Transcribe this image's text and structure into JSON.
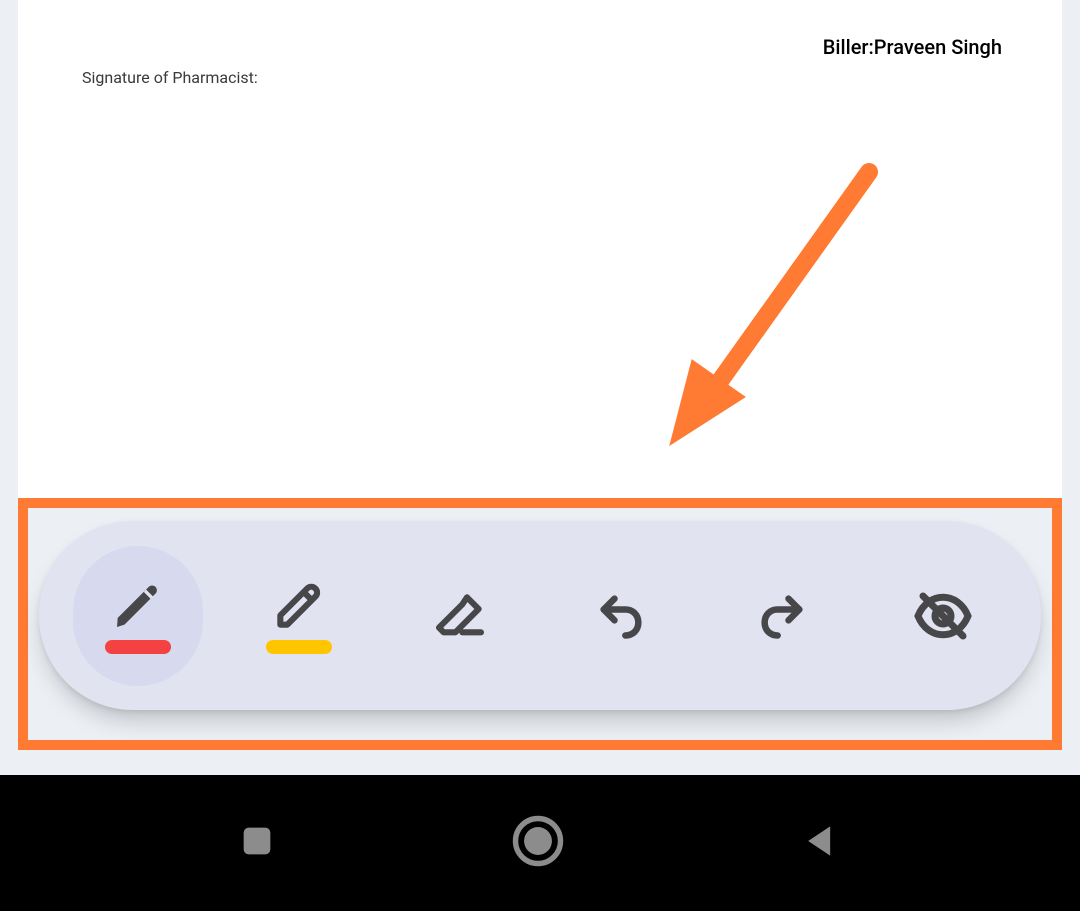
{
  "document": {
    "biller_label": "Biller:",
    "biller_name": "Praveen Singh",
    "signature_label": "Signature of Pharmacist:"
  },
  "annotation": {
    "arrow_color": "#ff7a33",
    "highlight_color": "#ff7a33"
  },
  "toolbar": {
    "tools": [
      {
        "name": "pen",
        "icon": "pen-icon",
        "active": true,
        "swatch": "#f44142"
      },
      {
        "name": "highlighter",
        "icon": "highlighter-icon",
        "active": false,
        "swatch": "#ffc600"
      },
      {
        "name": "eraser",
        "icon": "eraser-icon",
        "active": false
      },
      {
        "name": "undo",
        "icon": "undo-icon",
        "active": false
      },
      {
        "name": "redo",
        "icon": "redo-icon",
        "active": false
      },
      {
        "name": "hide",
        "icon": "eye-off-icon",
        "active": false
      }
    ]
  },
  "navbar": {
    "buttons": [
      {
        "name": "recent",
        "icon": "square-icon"
      },
      {
        "name": "home",
        "icon": "circle-icon"
      },
      {
        "name": "back",
        "icon": "triangle-left-icon"
      }
    ]
  }
}
